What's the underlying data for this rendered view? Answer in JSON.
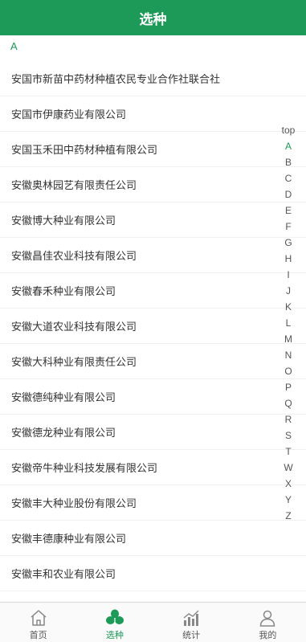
{
  "header": {
    "title": "选种"
  },
  "section": {
    "letter": "A"
  },
  "companies": [
    "安国市新苗中药材种植农民专业合作社联合社",
    "安国市伊康药业有限公司",
    "安国玉禾田中药材种植有限公司",
    "安徽奥林园艺有限责任公司",
    "安徽博大种业有限公司",
    "安徽昌佳农业科技有限公司",
    "安徽春禾种业有限公司",
    "安徽大道农业科技有限公司",
    "安徽大科种业有限责任公司",
    "安徽德纯种业有限公司",
    "安徽德龙种业有限公司",
    "安徽帝牛种业科技发展有限公司",
    "安徽丰大种业股份有限公司",
    "安徽丰德康种业有限公司",
    "安徽丰和农业有限公司"
  ],
  "index": {
    "letters": [
      "top",
      "A",
      "B",
      "C",
      "D",
      "E",
      "F",
      "G",
      "H",
      "I",
      "J",
      "K",
      "L",
      "M",
      "N",
      "O",
      "P",
      "Q",
      "R",
      "S",
      "T",
      "W",
      "X",
      "Y",
      "Z"
    ],
    "active": "A"
  },
  "tabbar": {
    "active": "selection",
    "tabs": [
      {
        "id": "home",
        "label": "首页",
        "icon": "home-icon"
      },
      {
        "id": "selection",
        "label": "选种",
        "icon": "clover-icon"
      },
      {
        "id": "stats",
        "label": "统计",
        "icon": "bar-chart-icon"
      },
      {
        "id": "mine",
        "label": "我的",
        "icon": "user-icon"
      }
    ]
  },
  "colors": {
    "brand": "#1d9a57",
    "text": "#333333",
    "inactive_icon": "#888888"
  }
}
